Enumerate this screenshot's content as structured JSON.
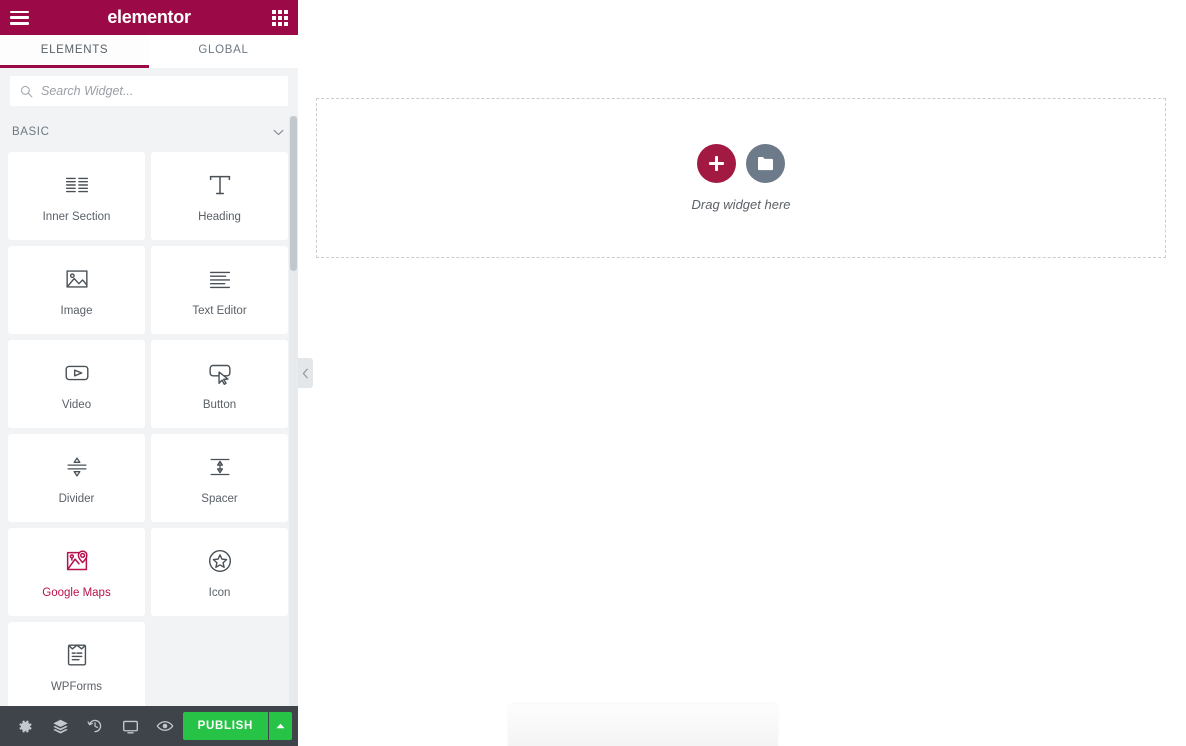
{
  "header": {
    "brand": "elementor",
    "menu_icon": "hamburger-icon",
    "apps_icon": "apps-grid-icon"
  },
  "tabs": [
    {
      "label": "ELEMENTS",
      "active": true
    },
    {
      "label": "GLOBAL",
      "active": false
    }
  ],
  "search": {
    "placeholder": "Search Widget...",
    "value": "",
    "icon": "search-icon"
  },
  "section": {
    "title": "BASIC",
    "toggle_icon": "chevron-down-icon",
    "expanded": true
  },
  "widgets": [
    {
      "label": "Inner Section",
      "icon": "inner-section-icon",
      "active": false
    },
    {
      "label": "Heading",
      "icon": "heading-icon",
      "active": false
    },
    {
      "label": "Image",
      "icon": "image-icon",
      "active": false
    },
    {
      "label": "Text Editor",
      "icon": "text-editor-icon",
      "active": false
    },
    {
      "label": "Video",
      "icon": "video-icon",
      "active": false
    },
    {
      "label": "Button",
      "icon": "button-icon",
      "active": false
    },
    {
      "label": "Divider",
      "icon": "divider-icon",
      "active": false
    },
    {
      "label": "Spacer",
      "icon": "spacer-icon",
      "active": false
    },
    {
      "label": "Google Maps",
      "icon": "google-maps-icon",
      "active": true
    },
    {
      "label": "Icon",
      "icon": "star-icon",
      "active": false
    },
    {
      "label": "WPForms",
      "icon": "wpforms-icon",
      "active": false
    }
  ],
  "footer": {
    "buttons": [
      {
        "name": "settings",
        "icon": "gear-icon"
      },
      {
        "name": "navigator",
        "icon": "layers-icon"
      },
      {
        "name": "history",
        "icon": "history-icon"
      },
      {
        "name": "responsive",
        "icon": "monitor-icon"
      },
      {
        "name": "preview",
        "icon": "eye-icon"
      }
    ],
    "publish_label": "PUBLISH",
    "publish_caret_icon": "caret-up-icon"
  },
  "collapse": {
    "icon": "chevron-left-icon"
  },
  "canvas": {
    "dropzone_label": "Drag widget here",
    "add_icon": "plus-icon",
    "folder_icon": "folder-icon"
  },
  "colors": {
    "brand": "#9b0a46",
    "accent": "#a21942",
    "active_widget": "#b8114e",
    "publish": "#27c346",
    "footer_bar": "#3f444b",
    "panel_bg": "#f1f3f5"
  }
}
